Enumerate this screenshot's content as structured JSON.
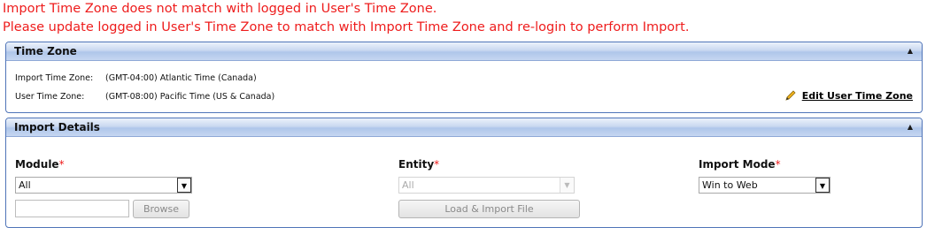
{
  "errors": {
    "line1": "Import Time Zone does not match with logged in User's Time Zone.",
    "line2": "Please update logged in User's Time Zone to match with Import Time Zone and re-login to perform Import."
  },
  "time_zone_panel": {
    "title": "Time Zone",
    "import_label": "Import Time Zone:",
    "import_value": "(GMT-04:00) Atlantic Time (Canada)",
    "user_label": "User Time Zone:",
    "user_value": "(GMT-08:00) Pacific Time (US & Canada)",
    "edit_link": "Edit User Time Zone"
  },
  "import_details_panel": {
    "title": "Import Details",
    "module": {
      "label": "Module",
      "required_mark": "*",
      "selected": "All",
      "file_value": "",
      "browse_label": "Browse"
    },
    "entity": {
      "label": "Entity",
      "required_mark": "*",
      "selected": "All",
      "disabled": true,
      "load_button": "Load & Import File"
    },
    "import_mode": {
      "label": "Import Mode",
      "required_mark": "*",
      "selected": "Win to Web"
    }
  },
  "colors": {
    "error_text": "#ee1c1c",
    "panel_border": "#4f74b8",
    "header_gradient_mid": "#afc6ea"
  }
}
